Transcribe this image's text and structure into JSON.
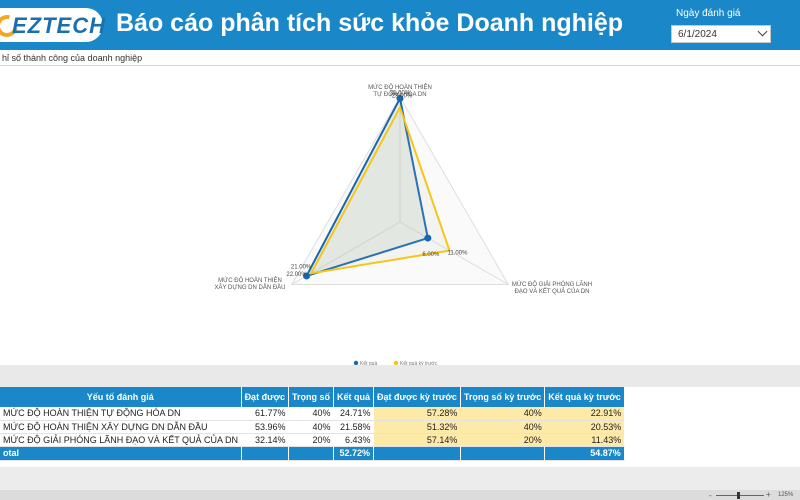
{
  "header": {
    "logo_text": "EZTECH",
    "title": "Báo cáo phân tích sức khỏe Doanh nghiệp",
    "date_label": "Ngày đánh giá",
    "date_value": "6/1/2024"
  },
  "chart_section": {
    "subtitle": "hỉ số thành công của doanh nghiệp"
  },
  "chart_data": {
    "type": "radar",
    "axes": [
      "MỨC ĐỘ HOÀN THIỆN TỰ ĐỘNG HÓA DN",
      "MỨC ĐỘ GIẢI PHÓNG LÃNH ĐẠO VÀ KẾT QUẢ CỦA DN",
      "MỨC ĐỘ HOÀN THIỆN XÂY DỰNG DN DẪN ĐẦU"
    ],
    "axis_label_lines": [
      [
        "MỨC ĐỘ HOÀN THIỆN",
        "TỰ ĐỘNG HÓA DN"
      ],
      [
        "MỨC ĐỘ GIẢI PHÓNG LÃNH",
        "ĐẠO VÀ KẾT QUẢ CỦA DN"
      ],
      [
        "MỨC ĐỘ HOÀN THIỆN",
        "XÂY DỰNG DN DẪN ĐẦU"
      ]
    ],
    "range": [
      0,
      25
    ],
    "series": [
      {
        "name": "Kết quả",
        "color": "#1766b0",
        "values": [
          24.71,
          6.43,
          21.58
        ],
        "labels": [
          "25.00%",
          "6.00%",
          "22.00%"
        ]
      },
      {
        "name": "Kết quả kỳ trước",
        "color": "#f5c518",
        "values": [
          22.91,
          11.43,
          20.53
        ],
        "labels": [
          "23.00%",
          "11.00%",
          "21.00%"
        ]
      }
    ],
    "grid": true,
    "legend_position": "bottom"
  },
  "table": {
    "headers": [
      "Yếu tố đánh giá",
      "Đạt được",
      "Trọng số",
      "Kết quả",
      "Đạt được kỳ trước",
      "Trọng số kỳ trước",
      "Kết quả kỳ trước"
    ],
    "rows": [
      [
        "MỨC ĐỘ HOÀN THIỆN TỰ ĐỘNG HÓA DN",
        "61.77%",
        "40%",
        "24.71%",
        "57.28%",
        "40%",
        "22.91%"
      ],
      [
        "MỨC ĐỘ HOÀN THIỆN XÂY DỰNG DN DẪN ĐẦU",
        "53.96%",
        "40%",
        "21.58%",
        "51.32%",
        "40%",
        "20.53%"
      ],
      [
        "MỨC ĐỘ GIẢI PHÓNG LÃNH ĐẠO VÀ KẾT QUẢ CỦA DN",
        "32.14%",
        "20%",
        "6.43%",
        "57.14%",
        "20%",
        "11.43%"
      ]
    ],
    "total": [
      "otal",
      "",
      "",
      "52.72%",
      "",
      "",
      "54.87%"
    ]
  },
  "footer": {
    "zoom_minus": "-",
    "zoom_plus": "+",
    "zoom_level": "125%"
  }
}
